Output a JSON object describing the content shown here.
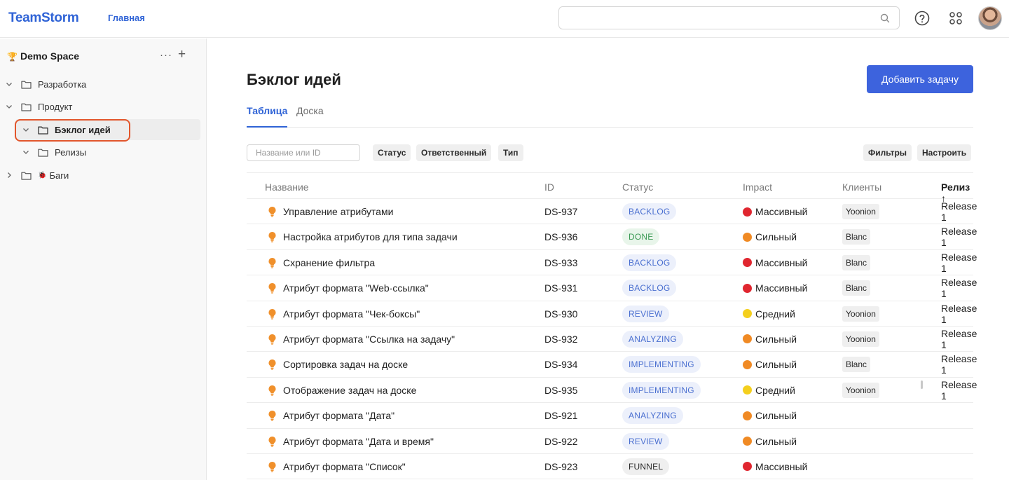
{
  "header": {
    "logo": "TeamStorm",
    "nav_home": "Главная",
    "search_placeholder": "",
    "icons": {
      "search": "search-icon",
      "help": "help-icon",
      "apps": "apps-grid-icon",
      "avatar": "avatar"
    }
  },
  "sidebar": {
    "space_name": "Demo Space",
    "space_icon": "🏆",
    "more_label": "···",
    "add_label": "+",
    "items": [
      {
        "label": "Разработка",
        "level": 0,
        "expanded": true
      },
      {
        "label": "Продукт",
        "level": 0,
        "expanded": true
      },
      {
        "label": "Бэклог идей",
        "level": 1,
        "expanded": true,
        "active": true
      },
      {
        "label": "Релизы",
        "level": 1,
        "expanded": true
      },
      {
        "label": "Баги",
        "level": 0,
        "expanded": false,
        "emoji": "🐞"
      }
    ]
  },
  "main": {
    "title": "Бэклог идей",
    "add_button": "Добавить задачу",
    "tabs": [
      {
        "label": "Таблица",
        "active": true
      },
      {
        "label": "Доска",
        "active": false
      }
    ],
    "filter_placeholder": "Название или ID",
    "filter_chips": [
      "Статус",
      "Ответственный",
      "Тип"
    ],
    "right_chips": [
      "Фильтры",
      "Настроить"
    ],
    "columns": [
      "Название",
      "ID",
      "Статус",
      "Impact",
      "Клиенты",
      "Релиз ↑"
    ],
    "rows": [
      {
        "name": "Управление атрибутами",
        "id": "DS-937",
        "status": "BACKLOG",
        "impact": "Массивный",
        "client": "Yoonion",
        "release": "Release 1"
      },
      {
        "name": "Настройка атрибутов для типа задачи",
        "id": "DS-936",
        "status": "DONE",
        "impact": "Сильный",
        "client": "Blanc",
        "release": "Release 1"
      },
      {
        "name": "Схранение фильтра",
        "id": "DS-933",
        "status": "BACKLOG",
        "impact": "Массивный",
        "client": "Blanc",
        "release": "Release 1"
      },
      {
        "name": "Атрибут формата \"Web-ссылка\"",
        "id": "DS-931",
        "status": "BACKLOG",
        "impact": "Массивный",
        "client": "Blanc",
        "release": "Release 1"
      },
      {
        "name": "Атрибут формата \"Чек-боксы\"",
        "id": "DS-930",
        "status": "REVIEW",
        "impact": "Средний",
        "client": "Yoonion",
        "release": "Release 1"
      },
      {
        "name": "Атрибут формата \"Ссылка на задачу\"",
        "id": "DS-932",
        "status": "ANALYZING",
        "impact": "Сильный",
        "client": "Yoonion",
        "release": "Release 1"
      },
      {
        "name": "Сортировка задач на доске",
        "id": "DS-934",
        "status": "IMPLEMENTING",
        "impact": "Сильный",
        "client": "Blanc",
        "release": "Release 1"
      },
      {
        "name": "Отображение задач на доске",
        "id": "DS-935",
        "status": "IMPLEMENTING",
        "impact": "Средний",
        "client": "Yoonion",
        "release": "Release 1"
      },
      {
        "name": "Атрибут формата \"Дата\"",
        "id": "DS-921",
        "status": "ANALYZING",
        "impact": "Сильный",
        "client": "",
        "release": ""
      },
      {
        "name": "Атрибут формата \"Дата и время\"",
        "id": "DS-922",
        "status": "REVIEW",
        "impact": "Сильный",
        "client": "",
        "release": ""
      },
      {
        "name": "Атрибут формата \"Список\"",
        "id": "DS-923",
        "status": "FUNNEL",
        "impact": "Массивный",
        "client": "",
        "release": ""
      }
    ]
  },
  "colors": {
    "accent": "#3d63dd",
    "status": {
      "BACKLOG": {
        "bg": "#ecf0fb",
        "fg": "#4a6fd0"
      },
      "DONE": {
        "bg": "#e8f5ea",
        "fg": "#3c9a55"
      },
      "REVIEW": {
        "bg": "#ecf0fb",
        "fg": "#4a6fd0"
      },
      "ANALYZING": {
        "bg": "#ecf0fb",
        "fg": "#4a6fd0"
      },
      "IMPLEMENTING": {
        "bg": "#ecf0fb",
        "fg": "#4a6fd0"
      },
      "FUNNEL": {
        "bg": "#efefef",
        "fg": "#2b2b2b"
      }
    },
    "impact": {
      "Массивный": "#e0262f",
      "Сильный": "#f08a24",
      "Средний": "#f4cf1d"
    }
  }
}
